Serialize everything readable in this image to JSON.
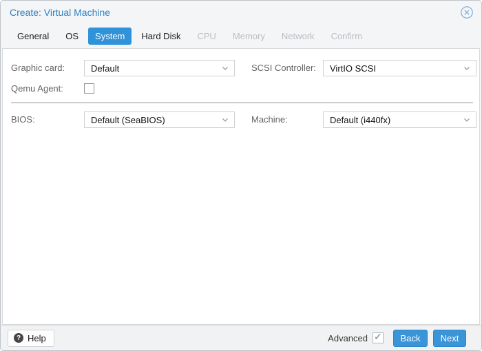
{
  "window": {
    "title": "Create: Virtual Machine"
  },
  "tabs": [
    {
      "label": "General",
      "state": "enabled"
    },
    {
      "label": "OS",
      "state": "enabled"
    },
    {
      "label": "System",
      "state": "active"
    },
    {
      "label": "Hard Disk",
      "state": "enabled"
    },
    {
      "label": "CPU",
      "state": "disabled"
    },
    {
      "label": "Memory",
      "state": "disabled"
    },
    {
      "label": "Network",
      "state": "disabled"
    },
    {
      "label": "Confirm",
      "state": "disabled"
    }
  ],
  "form": {
    "graphic_card": {
      "label": "Graphic card:",
      "type": "select",
      "value": "Default"
    },
    "scsi_controller": {
      "label": "SCSI Controller:",
      "type": "select",
      "value": "VirtIO SCSI"
    },
    "qemu_agent": {
      "label": "Qemu Agent:",
      "type": "checkbox",
      "checked": false
    },
    "bios": {
      "label": "BIOS:",
      "type": "select",
      "value": "Default (SeaBIOS)"
    },
    "machine": {
      "label": "Machine:",
      "type": "select",
      "value": "Default (i440fx)"
    }
  },
  "footer": {
    "help_label": "Help",
    "advanced_label": "Advanced",
    "advanced_checked": true,
    "back_label": "Back",
    "next_label": "Next"
  },
  "colors": {
    "accent_blue": "#3092d8",
    "title_blue": "#2e82c6",
    "label_gray": "#646464",
    "disabled_tab_gray": "#b9bec4",
    "separator_gray": "#8f8f8f"
  }
}
